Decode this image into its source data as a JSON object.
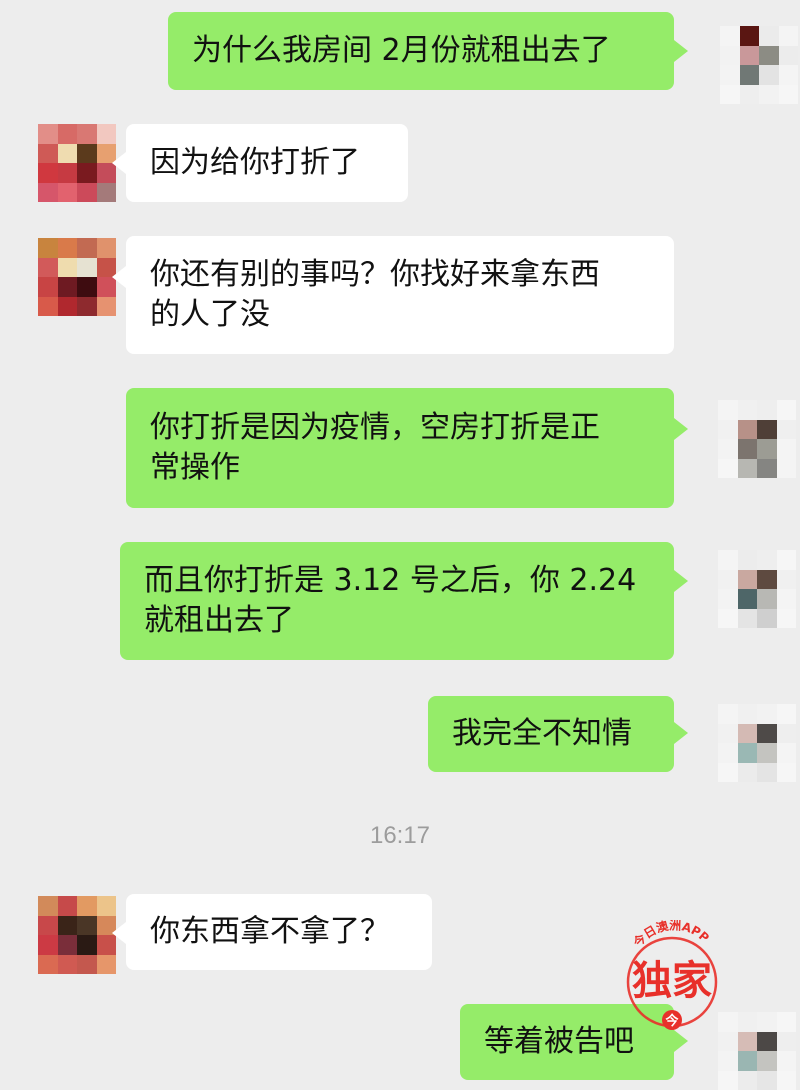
{
  "messages": [
    {
      "side": "me",
      "text": "为什么我房间 2月份就租出去了"
    },
    {
      "side": "them",
      "text": "因为给你打折了"
    },
    {
      "side": "them",
      "text": "你还有别的事吗？你找好来拿东西\n的人了没"
    },
    {
      "side": "me",
      "text": "你打折是因为疫情，空房打折是正\n常操作"
    },
    {
      "side": "me",
      "text": "而且你打折是 3.12 号之后，你 2.24\n就租出去了"
    },
    {
      "side": "me",
      "text": "我完全不知情"
    },
    {
      "side": "them",
      "text": "你东西拿不拿了？"
    },
    {
      "side": "me",
      "text": "等着被告吧"
    }
  ],
  "timestamp": "16:17",
  "watermark": {
    "arc_text": "今日澳洲APP",
    "main_text": "独家",
    "badge": "今"
  },
  "colors": {
    "me_bubble": "#95ec69",
    "them_bubble": "#ffffff",
    "background": "#ededed",
    "watermark_red": "#e8302a"
  }
}
